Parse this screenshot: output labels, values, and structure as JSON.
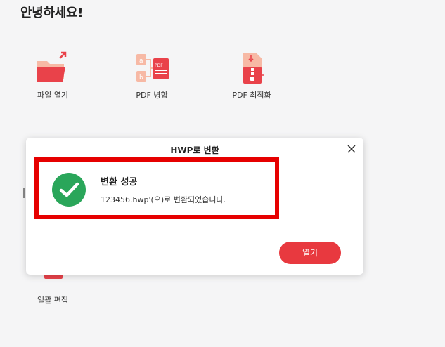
{
  "greeting": "안녕하세요!",
  "tools": {
    "open": {
      "label": "파일 열기",
      "icon": "folder-open-icon"
    },
    "merge": {
      "label": "PDF 병합",
      "icon": "pdf-merge-icon"
    },
    "optimize": {
      "label": "PDF 최적화",
      "icon": "pdf-compress-icon"
    },
    "batch": {
      "label": "일괄 편집",
      "icon": "batch-edit-icon"
    }
  },
  "dialog": {
    "title": "HWP로 변환",
    "success_title": "변환 성공",
    "success_message": "123456.hwp'(으)로 변환되었습니다.",
    "open_button": "열기"
  },
  "colors": {
    "accent": "#e8393f",
    "success": "#2aa65a",
    "highlight": "#e60000"
  }
}
